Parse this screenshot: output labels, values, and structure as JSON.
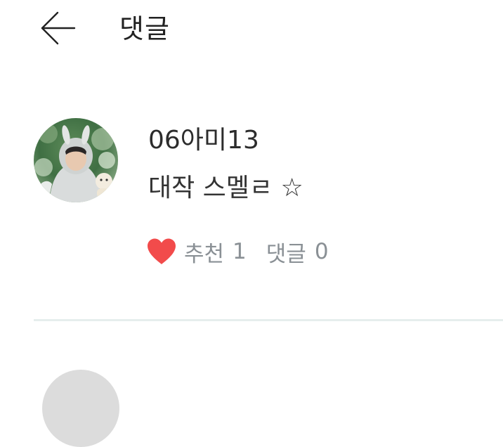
{
  "header": {
    "title": "댓글",
    "back_icon": "arrow-left-icon"
  },
  "comment": {
    "username": "06아미13",
    "text": "대작 스멜ㄹ ☆",
    "likes": {
      "icon": "heart-icon",
      "icon_color": "#f24b4b",
      "label": "추천",
      "count": "1"
    },
    "replies": {
      "label": "댓글",
      "count": "0"
    }
  },
  "colors": {
    "divider": "#e6eeed",
    "meta_text": "#8a9095"
  }
}
